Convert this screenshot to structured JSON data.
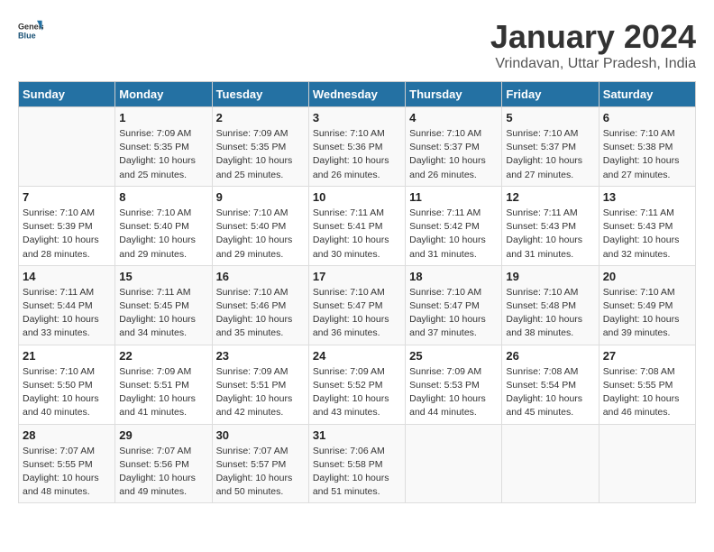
{
  "header": {
    "logo_general": "General",
    "logo_blue": "Blue",
    "month_title": "January 2024",
    "location": "Vrindavan, Uttar Pradesh, India"
  },
  "days_of_week": [
    "Sunday",
    "Monday",
    "Tuesday",
    "Wednesday",
    "Thursday",
    "Friday",
    "Saturday"
  ],
  "weeks": [
    [
      {
        "day": "",
        "info": ""
      },
      {
        "day": "1",
        "info": "Sunrise: 7:09 AM\nSunset: 5:35 PM\nDaylight: 10 hours\nand 25 minutes."
      },
      {
        "day": "2",
        "info": "Sunrise: 7:09 AM\nSunset: 5:35 PM\nDaylight: 10 hours\nand 25 minutes."
      },
      {
        "day": "3",
        "info": "Sunrise: 7:10 AM\nSunset: 5:36 PM\nDaylight: 10 hours\nand 26 minutes."
      },
      {
        "day": "4",
        "info": "Sunrise: 7:10 AM\nSunset: 5:37 PM\nDaylight: 10 hours\nand 26 minutes."
      },
      {
        "day": "5",
        "info": "Sunrise: 7:10 AM\nSunset: 5:37 PM\nDaylight: 10 hours\nand 27 minutes."
      },
      {
        "day": "6",
        "info": "Sunrise: 7:10 AM\nSunset: 5:38 PM\nDaylight: 10 hours\nand 27 minutes."
      }
    ],
    [
      {
        "day": "7",
        "info": "Sunrise: 7:10 AM\nSunset: 5:39 PM\nDaylight: 10 hours\nand 28 minutes."
      },
      {
        "day": "8",
        "info": "Sunrise: 7:10 AM\nSunset: 5:40 PM\nDaylight: 10 hours\nand 29 minutes."
      },
      {
        "day": "9",
        "info": "Sunrise: 7:10 AM\nSunset: 5:40 PM\nDaylight: 10 hours\nand 29 minutes."
      },
      {
        "day": "10",
        "info": "Sunrise: 7:11 AM\nSunset: 5:41 PM\nDaylight: 10 hours\nand 30 minutes."
      },
      {
        "day": "11",
        "info": "Sunrise: 7:11 AM\nSunset: 5:42 PM\nDaylight: 10 hours\nand 31 minutes."
      },
      {
        "day": "12",
        "info": "Sunrise: 7:11 AM\nSunset: 5:43 PM\nDaylight: 10 hours\nand 31 minutes."
      },
      {
        "day": "13",
        "info": "Sunrise: 7:11 AM\nSunset: 5:43 PM\nDaylight: 10 hours\nand 32 minutes."
      }
    ],
    [
      {
        "day": "14",
        "info": "Sunrise: 7:11 AM\nSunset: 5:44 PM\nDaylight: 10 hours\nand 33 minutes."
      },
      {
        "day": "15",
        "info": "Sunrise: 7:11 AM\nSunset: 5:45 PM\nDaylight: 10 hours\nand 34 minutes."
      },
      {
        "day": "16",
        "info": "Sunrise: 7:10 AM\nSunset: 5:46 PM\nDaylight: 10 hours\nand 35 minutes."
      },
      {
        "day": "17",
        "info": "Sunrise: 7:10 AM\nSunset: 5:47 PM\nDaylight: 10 hours\nand 36 minutes."
      },
      {
        "day": "18",
        "info": "Sunrise: 7:10 AM\nSunset: 5:47 PM\nDaylight: 10 hours\nand 37 minutes."
      },
      {
        "day": "19",
        "info": "Sunrise: 7:10 AM\nSunset: 5:48 PM\nDaylight: 10 hours\nand 38 minutes."
      },
      {
        "day": "20",
        "info": "Sunrise: 7:10 AM\nSunset: 5:49 PM\nDaylight: 10 hours\nand 39 minutes."
      }
    ],
    [
      {
        "day": "21",
        "info": "Sunrise: 7:10 AM\nSunset: 5:50 PM\nDaylight: 10 hours\nand 40 minutes."
      },
      {
        "day": "22",
        "info": "Sunrise: 7:09 AM\nSunset: 5:51 PM\nDaylight: 10 hours\nand 41 minutes."
      },
      {
        "day": "23",
        "info": "Sunrise: 7:09 AM\nSunset: 5:51 PM\nDaylight: 10 hours\nand 42 minutes."
      },
      {
        "day": "24",
        "info": "Sunrise: 7:09 AM\nSunset: 5:52 PM\nDaylight: 10 hours\nand 43 minutes."
      },
      {
        "day": "25",
        "info": "Sunrise: 7:09 AM\nSunset: 5:53 PM\nDaylight: 10 hours\nand 44 minutes."
      },
      {
        "day": "26",
        "info": "Sunrise: 7:08 AM\nSunset: 5:54 PM\nDaylight: 10 hours\nand 45 minutes."
      },
      {
        "day": "27",
        "info": "Sunrise: 7:08 AM\nSunset: 5:55 PM\nDaylight: 10 hours\nand 46 minutes."
      }
    ],
    [
      {
        "day": "28",
        "info": "Sunrise: 7:07 AM\nSunset: 5:55 PM\nDaylight: 10 hours\nand 48 minutes."
      },
      {
        "day": "29",
        "info": "Sunrise: 7:07 AM\nSunset: 5:56 PM\nDaylight: 10 hours\nand 49 minutes."
      },
      {
        "day": "30",
        "info": "Sunrise: 7:07 AM\nSunset: 5:57 PM\nDaylight: 10 hours\nand 50 minutes."
      },
      {
        "day": "31",
        "info": "Sunrise: 7:06 AM\nSunset: 5:58 PM\nDaylight: 10 hours\nand 51 minutes."
      },
      {
        "day": "",
        "info": ""
      },
      {
        "day": "",
        "info": ""
      },
      {
        "day": "",
        "info": ""
      }
    ]
  ]
}
